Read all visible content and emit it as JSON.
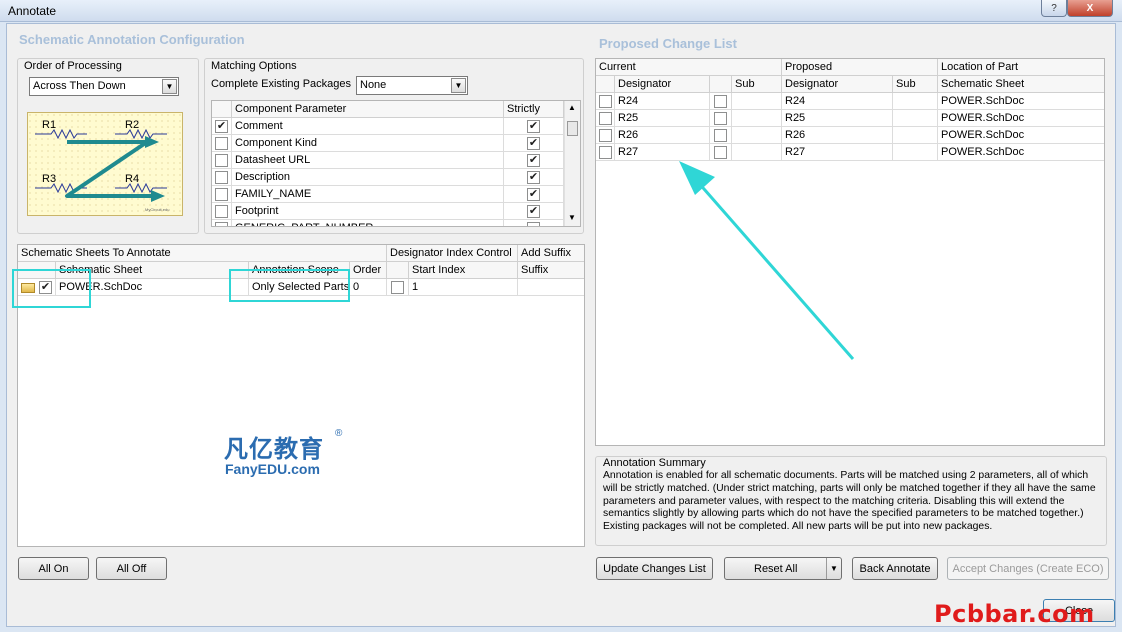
{
  "window": {
    "title": "Annotate",
    "help": "?",
    "close": "X"
  },
  "schematic_config": {
    "title": "Schematic Annotation Configuration",
    "order": {
      "label": "Order of Processing",
      "value": "Across Then Down",
      "diagram": {
        "r1": "R1",
        "r2": "R2",
        "r3": "R3",
        "r4": "R4",
        "credit": "MyCircuit.edu"
      }
    },
    "matching": {
      "label": "Matching Options",
      "complete_label": "Complete Existing Packages",
      "complete_value": "None",
      "headers": {
        "param": "Component Parameter",
        "strictly": "Strictly"
      },
      "rows": [
        {
          "name": "Comment",
          "checked": "✔",
          "strict": "✔"
        },
        {
          "name": "Component Kind",
          "checked": "",
          "strict": "✔"
        },
        {
          "name": "Datasheet URL",
          "checked": "",
          "strict": "✔"
        },
        {
          "name": "Description",
          "checked": "",
          "strict": "✔"
        },
        {
          "name": "FAMILY_NAME",
          "checked": "",
          "strict": "✔"
        },
        {
          "name": "Footprint",
          "checked": "",
          "strict": "✔"
        },
        {
          "name": "GENERIC_PART_NUMBER",
          "checked": "",
          "strict": ""
        }
      ]
    }
  },
  "sheets": {
    "headers": {
      "group": "Schematic Sheets To Annotate",
      "designator": "Designator Index Control",
      "suffix": "Add Suffix",
      "sheet": "Schematic Sheet",
      "scope": "Annotation Scope",
      "order": "Order",
      "start": "Start Index",
      "suffix_col": "Suffix"
    },
    "rows": [
      {
        "checked": "✔",
        "sheet": "POWER.SchDoc",
        "scope": "Only Selected Parts",
        "order": "0",
        "start": "1"
      }
    ]
  },
  "watermark": {
    "cn": "凡亿教育",
    "en": "FanyEDU.com",
    "reg": "®"
  },
  "buttons": {
    "all_on": "All On",
    "all_off": "All Off",
    "update": "Update Changes List",
    "reset": "Reset All",
    "back": "Back Annotate",
    "accept": "Accept Changes (Create ECO)",
    "close": "Close",
    "dropdown_glyph": "▼"
  },
  "changes": {
    "title": "Proposed Change List",
    "headers": {
      "current": "Current",
      "proposed": "Proposed",
      "location": "Location of Part",
      "designator": "Designator",
      "sub": "Sub",
      "p_designator": "Designator",
      "p_sub": "Sub",
      "sheet": "Schematic Sheet"
    },
    "rows": [
      {
        "cur": "R24",
        "prop": "R24",
        "sheet": "POWER.SchDoc"
      },
      {
        "cur": "R25",
        "prop": "R25",
        "sheet": "POWER.SchDoc"
      },
      {
        "cur": "R26",
        "prop": "R26",
        "sheet": "POWER.SchDoc"
      },
      {
        "cur": "R27",
        "prop": "R27",
        "sheet": "POWER.SchDoc"
      }
    ]
  },
  "summary": {
    "title": "Annotation Summary",
    "text": "Annotation is enabled for all schematic documents. Parts will be matched using 2 parameters, all of which will be strictly matched. (Under strict matching, parts will only be matched together if they all have the same parameters and parameter values, with respect to the matching criteria. Disabling this will extend the semantics slightly by allowing parts which do not have the specified parameters to be matched together.) Existing packages will not be completed. All new parts will be put into new packages."
  },
  "brand": "Pcbbar.com",
  "colors": {
    "highlight": "#2fd6d6",
    "section_title": "#a9c0da",
    "brand": "#e01b1b",
    "watermark": "#2b6cb0"
  }
}
